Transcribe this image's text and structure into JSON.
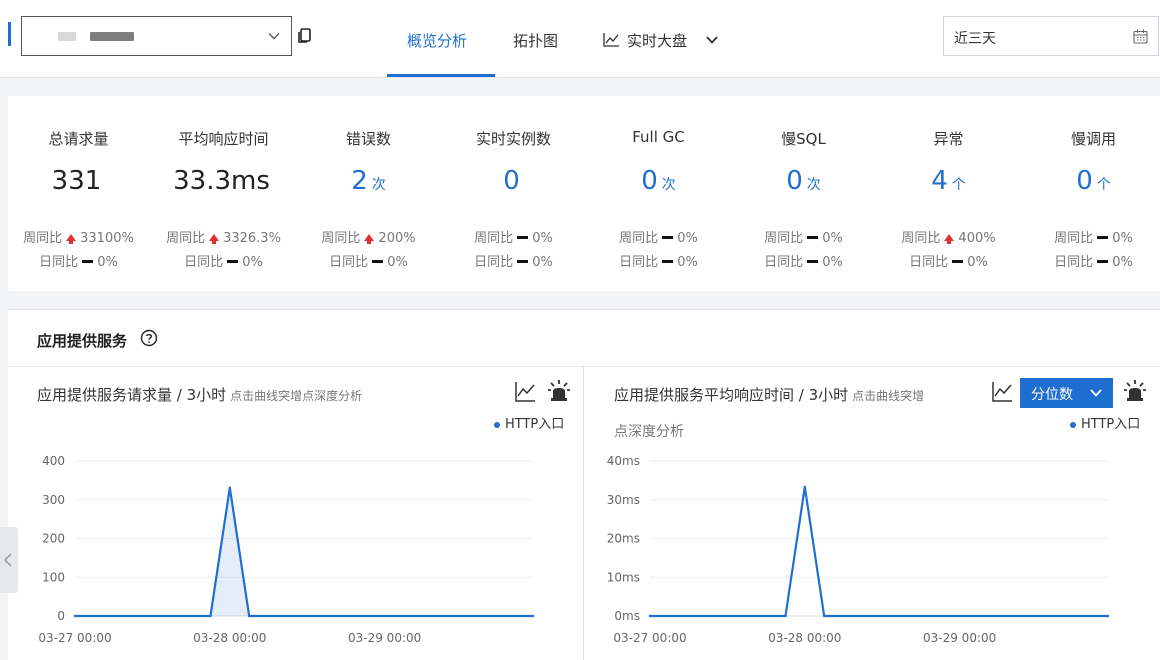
{
  "header": {
    "tabs": [
      {
        "label": "概览分析"
      },
      {
        "label": "拓扑图"
      },
      {
        "label": "实时大盘"
      }
    ],
    "date_range": "近三天"
  },
  "metrics": [
    {
      "label": "总请求量",
      "value": "331",
      "unit": "",
      "week": "33100%",
      "week_trend": "up",
      "day": "0%",
      "day_trend": "flat"
    },
    {
      "label": "平均响应时间",
      "value": "33.3ms",
      "unit": "",
      "week": "3326.3%",
      "week_trend": "up",
      "day": "0%",
      "day_trend": "flat"
    },
    {
      "label": "错误数",
      "value": "2",
      "unit": "次",
      "week": "200%",
      "week_trend": "up",
      "day": "0%",
      "day_trend": "flat"
    },
    {
      "label": "实时实例数",
      "value": "0",
      "unit": "",
      "week": "0%",
      "week_trend": "flat",
      "day": "0%",
      "day_trend": "flat"
    },
    {
      "label": "Full GC",
      "value": "0",
      "unit": "次",
      "week": "0%",
      "week_trend": "flat",
      "day": "0%",
      "day_trend": "flat"
    },
    {
      "label": "慢SQL",
      "value": "0",
      "unit": "次",
      "week": "0%",
      "week_trend": "flat",
      "day": "0%",
      "day_trend": "flat"
    },
    {
      "label": "异常",
      "value": "4",
      "unit": "个",
      "week": "400%",
      "week_trend": "up",
      "day": "0%",
      "day_trend": "flat"
    },
    {
      "label": "慢调用",
      "value": "0",
      "unit": "个",
      "week": "0%",
      "week_trend": "flat",
      "day": "0%",
      "day_trend": "flat"
    }
  ],
  "labels": {
    "week_compare": "周同比",
    "day_compare": "日同比"
  },
  "services": {
    "title": "应用提供服务",
    "percentile_button": "分位数"
  },
  "charts": [
    {
      "title": "应用提供服务请求量 / 3小时",
      "hint": "点击曲线突增点深度分析",
      "hint_line2": ""
    },
    {
      "title": "应用提供服务平均响应时间 / 3小时",
      "hint": "点击曲线突增",
      "hint_line2": "点深度分析"
    }
  ],
  "chart_data": [
    {
      "type": "area",
      "title": "应用提供服务请求量 / 3小时",
      "x": [
        "03-27 00:00",
        "03-27 21:00",
        "03-28 00:00",
        "03-28 03:00",
        "03-29 23:00"
      ],
      "series": [
        {
          "name": "HTTP入口",
          "values": [
            0,
            0,
            331,
            0,
            0
          ]
        }
      ],
      "x_ticks": [
        "03-27 00:00",
        "03-28 00:00",
        "03-29 00:00"
      ],
      "y_ticks": [
        "0",
        "100",
        "200",
        "300",
        "400"
      ],
      "ylim": [
        0,
        400
      ],
      "grid": true,
      "legend": "top-right",
      "color": "#1f6fd1"
    },
    {
      "type": "line",
      "title": "应用提供服务平均响应时间 / 3小时",
      "x": [
        "03-27 00:00",
        "03-27 21:00",
        "03-28 00:00",
        "03-28 03:00",
        "03-29 23:00"
      ],
      "series": [
        {
          "name": "HTTP入口",
          "values": [
            0,
            0,
            33.3,
            0,
            0
          ]
        }
      ],
      "x_ticks": [
        "03-27 00:00",
        "03-28 00:00",
        "03-29 00:00"
      ],
      "y_ticks": [
        "0ms",
        "10ms",
        "20ms",
        "30ms",
        "40ms"
      ],
      "ylim": [
        0,
        40
      ],
      "grid": true,
      "legend": "top-right",
      "color": "#1f6fd1"
    }
  ]
}
